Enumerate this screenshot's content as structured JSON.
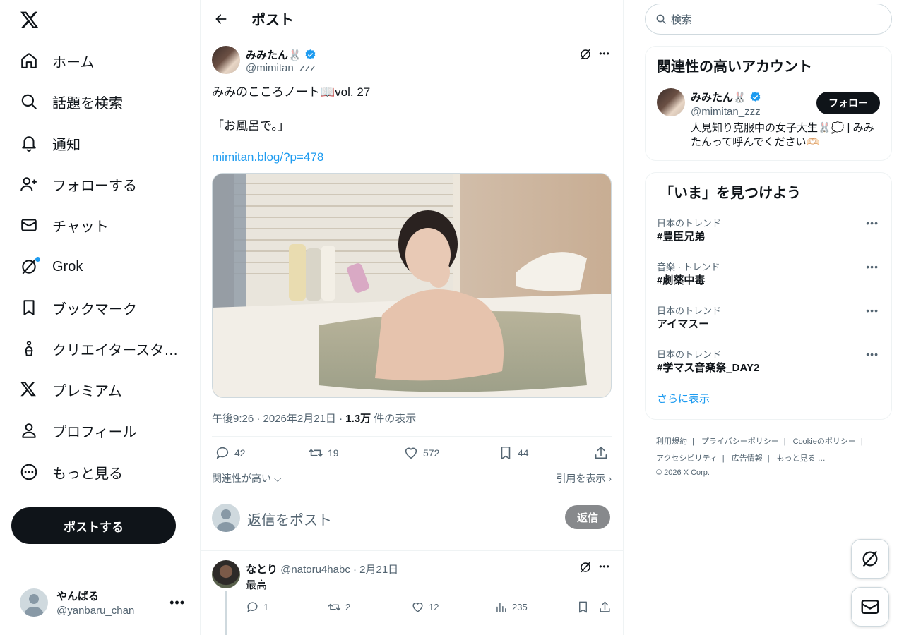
{
  "nav": {
    "items": [
      {
        "label": "ホーム",
        "icon": "home-icon"
      },
      {
        "label": "話題を検索",
        "icon": "search-icon"
      },
      {
        "label": "通知",
        "icon": "bell-icon"
      },
      {
        "label": "フォローする",
        "icon": "person-plus-icon"
      },
      {
        "label": "チャット",
        "icon": "envelope-icon"
      },
      {
        "label": "Grok",
        "icon": "grok-icon"
      },
      {
        "label": "ブックマーク",
        "icon": "bookmark-icon"
      },
      {
        "label": "クリエイタースタ…",
        "icon": "creator-icon"
      },
      {
        "label": "プレミアム",
        "icon": "x-logo-icon"
      },
      {
        "label": "プロフィール",
        "icon": "person-icon"
      },
      {
        "label": "もっと見る",
        "icon": "more-circle-icon"
      }
    ],
    "post_button": "ポストする",
    "account": {
      "name": "やんばる",
      "handle": "@yanbaru_chan"
    }
  },
  "header": {
    "title": "ポスト"
  },
  "post": {
    "author_name": "みみたん🐰",
    "author_handle": "@mimitan_zzz",
    "text_line1": "みみのこころノート📖vol. 27",
    "text_line2": "「お風呂で。」",
    "link": "mimitan.blog/?p=478",
    "time": "午後9:26 · 2026年2月21日 · ",
    "views": "1.3万",
    "views_suffix": " 件の表示",
    "replies": "42",
    "reposts": "19",
    "likes": "572",
    "bookmarks": "44",
    "sort_label": "関連性が高い",
    "quotes_label": "引用を表示"
  },
  "reply_box": {
    "placeholder": "返信をポスト",
    "button": "返信"
  },
  "reply": {
    "name": "なとり",
    "handle": "@natoru4habc",
    "date": " · 2月21日",
    "text": "最高",
    "replies": "1",
    "reposts": "2",
    "likes": "12",
    "views": "235"
  },
  "search": {
    "placeholder": "検索"
  },
  "related": {
    "title": "関連性の高いアカウント",
    "name": "みみたん🐰",
    "handle": "@mimitan_zzz",
    "follow": "フォロー",
    "bio": "人見知り克服中の女子大生🐰💭 | みみたんって呼んでください🫶🏻"
  },
  "trends": {
    "title": "「いま」を見つけよう",
    "items": [
      {
        "category": "日本のトレンド",
        "topic": "#豊臣兄弟"
      },
      {
        "category": "音楽 · トレンド",
        "topic": "#劇薬中毒"
      },
      {
        "category": "日本のトレンド",
        "topic": "アイマスー"
      },
      {
        "category": "日本のトレンド",
        "topic": "#学マス音楽祭_DAY2"
      }
    ],
    "show_more": "さらに表示"
  },
  "footer": {
    "terms": "利用規約",
    "privacy": "プライバシーポリシー",
    "cookie": "Cookieのポリシー",
    "accessibility": "アクセシビリティ",
    "ads": "広告情報",
    "more": "もっと見る …",
    "copyright": "© 2026 X Corp."
  },
  "colors": {
    "accent": "#1d9bf0",
    "text": "#0f1419",
    "muted": "#536471",
    "border": "#eff3f4"
  }
}
